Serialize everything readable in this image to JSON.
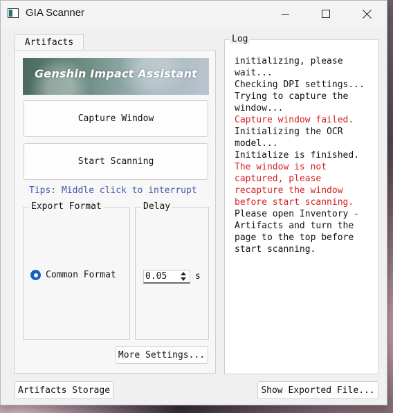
{
  "window": {
    "title": "GIA Scanner"
  },
  "tabs": [
    {
      "label": "Artifacts"
    }
  ],
  "banner": {
    "text": "Genshin Impact Assistant"
  },
  "buttons": {
    "capture": "Capture Window",
    "start": "Start Scanning",
    "more_settings": "More Settings...",
    "artifacts_storage": "Artifacts Storage",
    "show_exported": "Show Exported File..."
  },
  "tips": "Tips: Middle click to interrupt",
  "export_format": {
    "title": "Export Format",
    "option": "Common Format",
    "selected": true
  },
  "delay": {
    "title": "Delay",
    "value": "0.05",
    "unit": "s"
  },
  "log": {
    "title": "Log",
    "lines": [
      {
        "text": "initializing, please wait...",
        "error": false
      },
      {
        "text": "Checking DPI settings...",
        "error": false
      },
      {
        "text": "Trying to capture the window...",
        "error": false
      },
      {
        "text": "Capture window failed.",
        "error": true
      },
      {
        "text": "Initializing the OCR model...",
        "error": false
      },
      {
        "text": "Initialize is finished.",
        "error": false
      },
      {
        "text": "The window is not captured, please recapture the window before start scanning.",
        "error": true
      },
      {
        "text": "Please open Inventory - Artifacts and turn the page to the top before start scanning.",
        "error": false
      }
    ]
  },
  "colors": {
    "tips": "#4659a8",
    "error": "#d32020",
    "radio": "#1660c4"
  },
  "icons": {
    "app": "scanner-app-icon",
    "minimize": "minimize-icon",
    "maximize": "maximize-icon",
    "close": "close-icon",
    "spin_up": "spin-up-arrow-icon",
    "spin_down": "spin-down-arrow-icon"
  }
}
